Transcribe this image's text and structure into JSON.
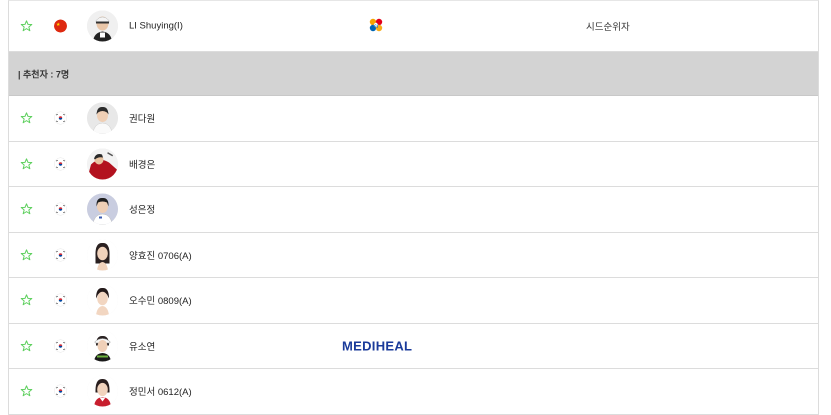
{
  "top_player": {
    "name": "LI Shuying(I)",
    "flag_icon": "china-flag-icon",
    "sponsor_icon": "cj-logo-icon",
    "note": "시드순위자"
  },
  "section": {
    "label": "| 추천자 : 7명"
  },
  "players": [
    {
      "name": "권다원",
      "flag_icon": "korea-flag-icon",
      "sponsor": ""
    },
    {
      "name": "배경은",
      "flag_icon": "korea-flag-icon",
      "sponsor": ""
    },
    {
      "name": "성은정",
      "flag_icon": "korea-flag-icon",
      "sponsor": ""
    },
    {
      "name": "양효진 0706(A)",
      "flag_icon": "korea-flag-icon",
      "sponsor": ""
    },
    {
      "name": "오수민 0809(A)",
      "flag_icon": "korea-flag-icon",
      "sponsor": ""
    },
    {
      "name": "유소연",
      "flag_icon": "korea-flag-icon",
      "sponsor": "MEDIHEAL"
    },
    {
      "name": "정민서 0612(A)",
      "flag_icon": "korea-flag-icon",
      "sponsor": ""
    }
  ],
  "colors": {
    "star_outline": "#5ccf5c",
    "section_bg": "#d3d3d3",
    "mediheal_blue": "#1a3a9a"
  }
}
